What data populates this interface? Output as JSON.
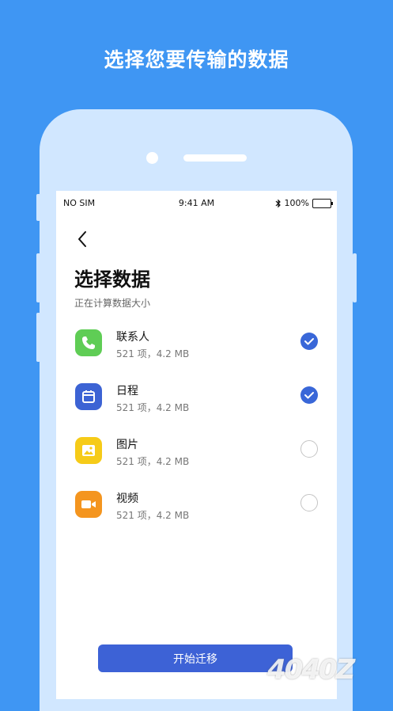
{
  "headline": "选择您要传输的数据",
  "status_bar": {
    "carrier": "NO SIM",
    "time": "9:41 AM",
    "battery": "100%"
  },
  "page": {
    "title": "选择数据",
    "subtitle": "正在计算数据大小"
  },
  "items": [
    {
      "name": "联系人",
      "meta": "521 项，4.2 MB",
      "selected": true,
      "icon": "phone-icon",
      "color": "#5fcd55"
    },
    {
      "name": "日程",
      "meta": "521 项，4.2 MB",
      "selected": true,
      "icon": "calendar-icon",
      "color": "#3c63d4"
    },
    {
      "name": "图片",
      "meta": "521 项，4.2 MB",
      "selected": false,
      "icon": "image-icon",
      "color": "#f6cb18"
    },
    {
      "name": "视频",
      "meta": "521 项，4.2 MB",
      "selected": false,
      "icon": "video-icon",
      "color": "#f4951f"
    }
  ],
  "start_button": "开始迁移",
  "watermark": "4040Z"
}
